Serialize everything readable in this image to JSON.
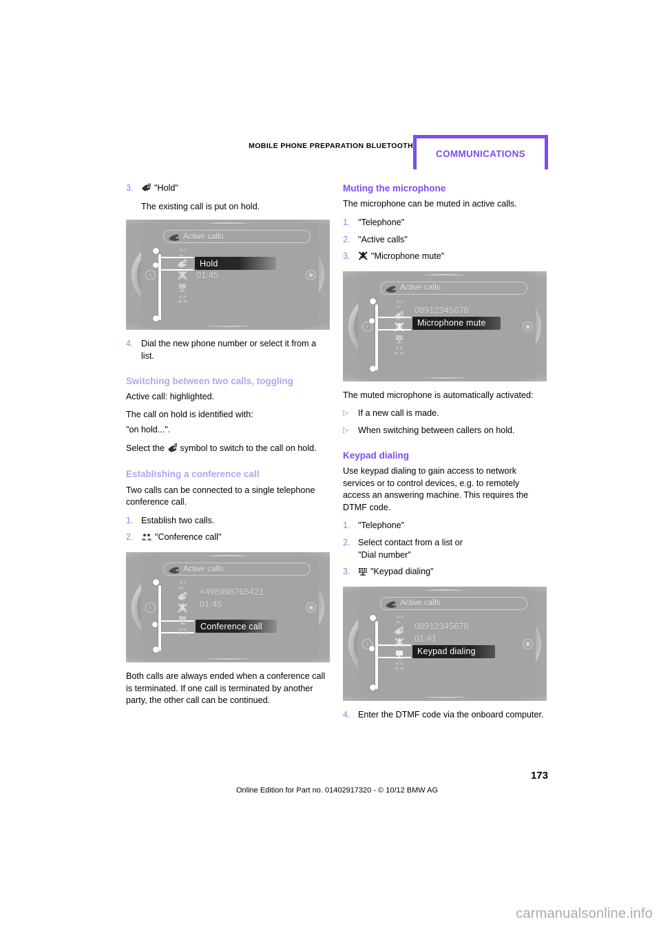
{
  "header": {
    "running_title": "MOBILE PHONE PREPARATION BLUETOOTH",
    "chapter_tab": "COMMUNICATIONS",
    "accent_color": "#7B4DF0"
  },
  "colors": {
    "heading_light": "#B8A2EE",
    "heading_strong": "#7B4DF0",
    "list_marker": "#9B7BE8",
    "body_text": "#000000"
  },
  "left_column": {
    "step3": {
      "number": "3.",
      "icon": "hold-call-icon",
      "label": "\"Hold\""
    },
    "step3_note": "The existing call is put on hold.",
    "figure_hold": {
      "title": "Active calls",
      "title_icon": "phone-handset-icon",
      "nub_left": "‹",
      "nub_right": "◉",
      "highlight": "Hold",
      "duration": "01:45",
      "menu_icons": [
        "contacts-icon",
        "hold-call-icon",
        "microphone-mute-icon",
        "keypad-icon",
        "conference-call-icon",
        "end-call-icon"
      ]
    },
    "step4": {
      "number": "4.",
      "text": "Dial the new phone number or select it from a list."
    },
    "h_switching": "Switching between two calls, toggling",
    "switching_p1": "Active call: highlighted.",
    "switching_p2_line1": "The call on hold is identified with:",
    "switching_p2_line2": "\"on hold...\".",
    "switching_p3_pre": "Select the",
    "switching_p3_icon": "toggle-call-icon",
    "switching_p3_post": "symbol to switch to the call on hold.",
    "h_conference": "Establishing a conference call",
    "conference_p1": "Two calls can be connected to a single telephone conference call.",
    "conf_step1": {
      "number": "1.",
      "text": "Establish two calls."
    },
    "conf_step2": {
      "number": "2.",
      "icon": "conference-call-icon",
      "label": "\"Conference call\""
    },
    "figure_conference": {
      "title": "Active calls",
      "title_icon": "phone-handset-icon",
      "nub_left": "‹",
      "nub_right": "◉",
      "phone_number": "+498998765421",
      "duration": "01:45",
      "highlight": "Conference call"
    },
    "conference_p2": "Both calls are always ended when a conference call is terminated. If one call is terminated by another party, the other call can be continued."
  },
  "right_column": {
    "h_muting": "Muting the microphone",
    "muting_p1": "The microphone can be muted in active calls.",
    "mute_step1": {
      "number": "1.",
      "text": "\"Telephone\""
    },
    "mute_step2": {
      "number": "2.",
      "text": "\"Active calls\""
    },
    "mute_step3": {
      "number": "3.",
      "icon": "microphone-mute-icon",
      "label": "\"Microphone mute\""
    },
    "figure_mute": {
      "title": "Active calls",
      "title_icon": "phone-handset-icon",
      "nub_left": "‹",
      "nub_right": "◉",
      "phone_number": "08912345678",
      "highlight": "Microphone mute"
    },
    "muting_p2": "The muted microphone is automatically activated:",
    "bullets": [
      {
        "marker": "▷",
        "text": "If a new call is made."
      },
      {
        "marker": "▷",
        "text": "When switching between callers on hold."
      }
    ],
    "h_keypad": "Keypad dialing",
    "keypad_p1": "Use keypad dialing to gain access to network services or to control devices, e.g. to remotely access an answering machine. This requires the DTMF code.",
    "keypad_step1": {
      "number": "1.",
      "text": "\"Telephone\""
    },
    "keypad_step2": {
      "number": "2.",
      "line1": "Select contact from a list or",
      "line2": "\"Dial number\""
    },
    "keypad_step3": {
      "number": "3.",
      "icon": "keypad-icon",
      "label": "\"Keypad dialing\""
    },
    "figure_keypad": {
      "title": "Active calls",
      "title_icon": "phone-handset-icon",
      "nub_left": "‹",
      "nub_right": "◉",
      "phone_number": "08912345678",
      "duration": "01:41",
      "highlight": "Keypad dialing"
    },
    "keypad_step4": {
      "number": "4.",
      "text": "Enter the DTMF code via the onboard computer."
    }
  },
  "footer": {
    "page_number": "173",
    "edition_line": "Online Edition for Part no. 01402917320 - © 10/12 BMW AG"
  },
  "watermark": "carmanualsonline.info"
}
